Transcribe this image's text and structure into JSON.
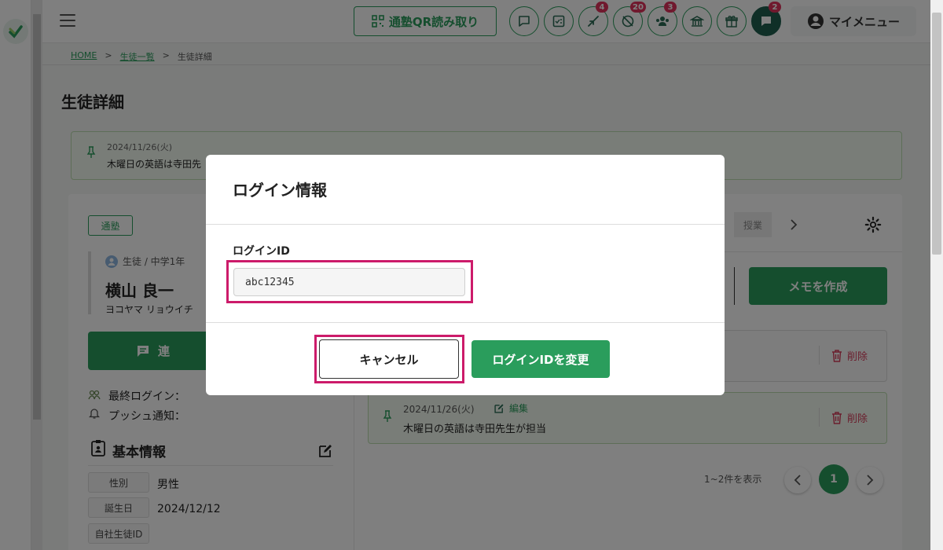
{
  "header": {
    "qr_button": "通塾QR読み取り",
    "badges": {
      "checkin": "4",
      "absent": "20",
      "group": "3",
      "messages": "2"
    },
    "my_menu": "マイメニュー"
  },
  "breadcrumb": {
    "home": "HOME",
    "list": "生徒一覧",
    "current": "生徒詳細",
    "sep": ">"
  },
  "page_title": "生徒詳細",
  "notice": {
    "date": "2024/11/26(火)",
    "text": "木曜日の英語は寺田先"
  },
  "student": {
    "status_tag": "通塾",
    "grade": "生徒 / 中学1年",
    "name": "横山 良一",
    "kana": "ヨコヤマ リョウイチ",
    "contact_button": "連",
    "last_login_label": "最終ログイン：",
    "push_label": "プッシュ通知："
  },
  "basic_info": {
    "title": "基本情報",
    "fields": [
      {
        "label": "性別",
        "value": "男性"
      },
      {
        "label": "誕生日",
        "value": "2024/12/12"
      },
      {
        "label": "自社生徒ID",
        "value": ""
      }
    ]
  },
  "right_panel": {
    "tab_partial": "授業",
    "create_memo": "メモを作成",
    "memos": [
      {
        "date": "",
        "edit": "",
        "text": "",
        "delete": "削除"
      },
      {
        "date": "2024/11/26(火)",
        "edit": "編集",
        "text": "木曜日の英語は寺田先生が担当",
        "delete": "削除"
      }
    ],
    "pagination": {
      "summary": "1~2件を表示",
      "page": "1"
    }
  },
  "modal": {
    "title": "ログイン情報",
    "field_label": "ログインID",
    "field_value": "abc12345",
    "cancel": "キャンセル",
    "confirm": "ログインIDを変更"
  },
  "colors": {
    "accent": "#2a9d5c",
    "highlight": "#cc1b6a",
    "danger": "#d63c5a",
    "badge": "#e0325c"
  }
}
